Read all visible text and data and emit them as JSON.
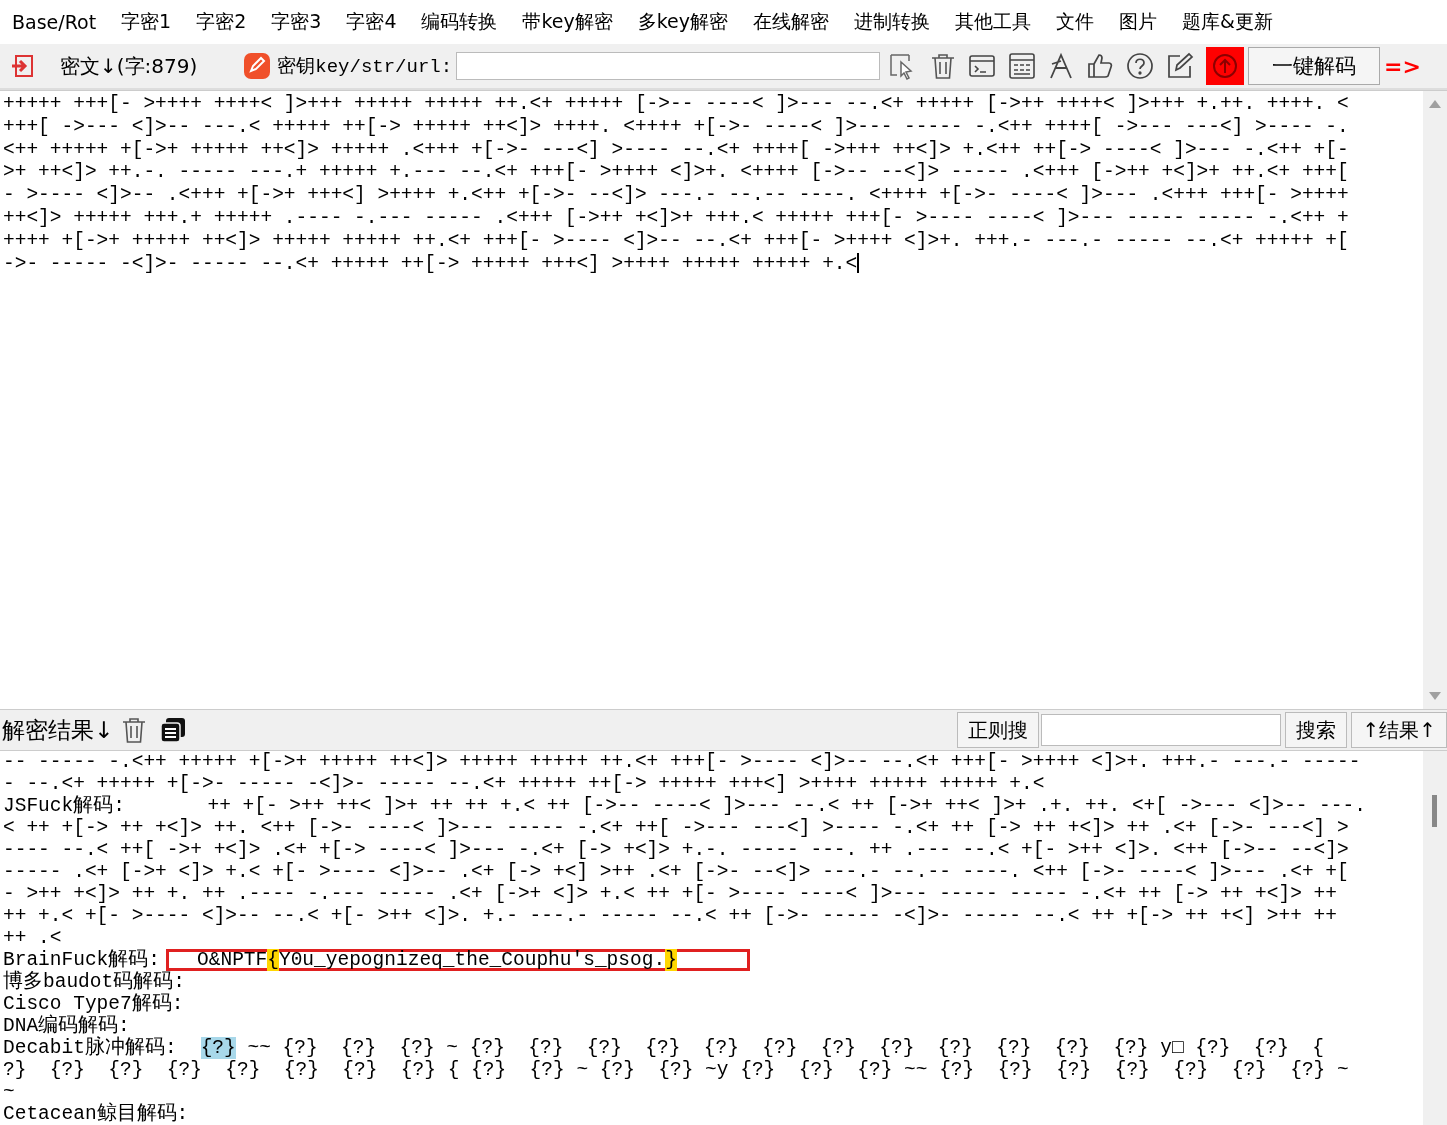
{
  "menu": [
    "Base/Rot",
    "字密1",
    "字密2",
    "字密3",
    "字密4",
    "编码转换",
    "带key解密",
    "多key解密",
    "在线解密",
    "进制转换",
    "其他工具",
    "文件",
    "图片",
    "题库&更新"
  ],
  "toolbar": {
    "cipher_label": "密文↓(字:879)",
    "key_label": "密钥key/str/url:",
    "decode_button": "一键解码",
    "arrow": "=>"
  },
  "input": {
    "lines": [
      "+++++ +++[- >++++ ++++< ]>+++ +++++ +++++ ++.<+ +++++ [->-- ----< ]>--- --.<+ +++++ [->++ ++++< ]>+++ +.++. ++++. <",
      "+++[ ->--- <]>-- ---.< +++++ ++[-> +++++ ++<]> ++++. <++++ +[->- ----< ]>--- ----- -.<++ ++++[ ->--- ---<] >---- -.",
      "<++ +++++ +[->+ +++++ ++<]> +++++ .<+++ +[->- ---<] >---- --.<+ ++++[ ->+++ ++<]> +.<++ ++[-> ----< ]>--- -.<++ +[-",
      ">+ ++<]> ++.-. ----- ---.+ +++++ +.--- --.<+ +++[- >++++ <]>+. <++++ [->-- --<]> ----- .<+++ [->++ +<]>+ ++.<+ +++[",
      "- >---- <]>-- .<+++ +[->+ +++<] >++++ +.<++ +[->- --<]> ---.- --.-- ----. <++++ +[->- ----< ]>--- .<+++ +++[- >++++",
      "++<]> +++++ +++.+ +++++ .---- -.--- ----- .<+++ [->++ +<]>+ +++.< +++++ +++[- >---- ----< ]>--- ----- ----- -.<++ +",
      "++++ +[->+ +++++ ++<]> +++++ +++++ ++.<+ +++[- >---- <]>-- --.<+ +++[- >++++ <]>+. +++.- ---.- ----- --.<+ +++++ +[",
      "->- ----- -<]>- ----- --.<+ +++++ ++[-> +++++ +++<] >++++ +++++ +++++ +.<"
    ]
  },
  "result_bar": {
    "label": "解密结果↓",
    "regex_button": "正则搜",
    "search_button": "搜索",
    "results_button": "↑结果↑"
  },
  "results": [
    {
      "segments": [
        {
          "text": "-- ----- -.<++ +++++ +[->+ +++++ ++<]> +++++ +++++ ++.<+ +++[- >---- <]>-- --.<+ +++[- >++++ <]>+. +++.- ---.- -----"
        }
      ]
    },
    {
      "segments": [
        {
          "text": "- --.<+ +++++ +[->- ----- -<]>- ----- --.<+ +++++ ++[-> +++++ +++<] >++++ +++++ +++++ +.<"
        }
      ]
    },
    {
      "label": "JSFuck解码:",
      "segments": [
        {
          "text": "     ++ +[- >++ ++< ]>+ ++ ++ +.< ++ [->-- ----< ]>--- --.< ++ [->+ ++< ]>+ .+. ++. <+[ ->--- <]>-- ---."
        }
      ]
    },
    {
      "segments": [
        {
          "text": "< ++ +[-> ++ +<]> ++. <++ [->- ----< ]>--- ----- -.<+ ++[ ->--- ---<] >---- -.<+ ++ [-> ++ +<]> ++ .<+ [->- ---<] >"
        }
      ]
    },
    {
      "segments": [
        {
          "text": "---- --.< ++[ ->+ +<]> .<+ +[-> ----< ]>--- -.<+ [-> +<]> +.-. ----- ---. ++ .--- --.< +[- >++ <]>. <++ [->-- --<]>"
        }
      ]
    },
    {
      "segments": [
        {
          "text": "----- .<+ [->+ <]> +.< +[- >---- <]>-- .<+ [-> +<] >++ .<+ [->- --<]> ---.- --.-- ----. <++ [->- ----< ]>--- .<+ +["
        }
      ]
    },
    {
      "segments": [
        {
          "text": "- >++ +<]> ++ +. ++ .---- -.--- ----- .<+ [->+ <]> +.< ++ +[- >---- ----< ]>--- ----- ----- -.<+ ++ [-> ++ +<]> ++"
        }
      ]
    },
    {
      "segments": [
        {
          "text": "++ +.< +[- >---- <]>-- --.< +[- >++ <]>. +.- ---.- ----- --.< ++ [->- ----- -<]>- ----- --.< ++ +[-> ++ +<] >++ ++"
        }
      ]
    },
    {
      "segments": [
        {
          "text": "++ .<"
        }
      ]
    },
    {
      "label": "BrainFuck解码:",
      "boxed": true,
      "segments": [
        {
          "text": "O&NPTF"
        },
        {
          "text": "{",
          "color": "#ffd700"
        },
        {
          "text": "Y0u_yepognizeq_the_Couphu's_psog."
        },
        {
          "text": "}",
          "color": "#ffd700"
        }
      ]
    },
    {
      "label": "博多baudot码解码:"
    },
    {
      "label": "Cisco Type7解码:"
    },
    {
      "label": "DNA编码解码:"
    },
    {
      "label": "Decabit脉冲解码:",
      "segments": [
        {
          "text": "{?}",
          "color": "#a8d8ea"
        },
        {
          "text": " ~~ {?}  {?}  {?} ~ {?}  {?}  {?}  {?}  {?}  {?}  {?}  {?}  {?}  {?}  {?}  {?} y□ {?}  {?}  {"
        }
      ]
    },
    {
      "segments": [
        {
          "text": "?}  {?}  {?}  {?}  {?}  {?}  {?}  {?} { {?}  {?} ~ {?}  {?} ~y {?}  {?}  {?} ~~ {?}  {?}  {?}  {?}  {?}  {?}  {?} ~"
        }
      ]
    },
    {
      "segments": [
        {
          "text": "~"
        }
      ]
    },
    {
      "label": "Cetacean鲸目解码:"
    }
  ]
}
